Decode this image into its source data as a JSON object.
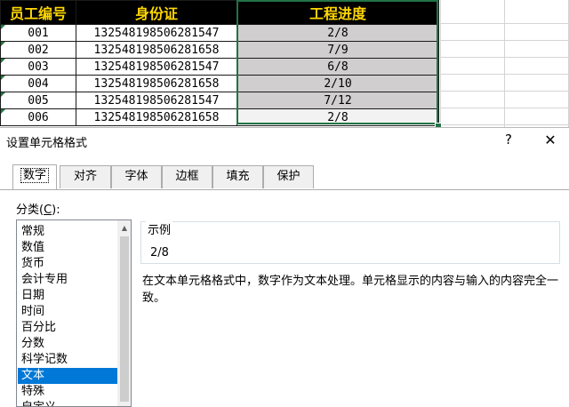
{
  "sheet": {
    "headers": [
      "员工编号",
      "身份证",
      "工程进度"
    ],
    "rows": [
      [
        "001",
        "13254819850628154​7",
        "2/8"
      ],
      [
        "002",
        "132548198506281658",
        "7/9"
      ],
      [
        "003",
        "132548198506281547",
        "6/8"
      ],
      [
        "004",
        "132548198506281658",
        "2/10"
      ],
      [
        "005",
        "132548198506281547",
        "7/12"
      ],
      [
        "006",
        "132548198506281658",
        "2/8"
      ]
    ],
    "header_bg": "#000000",
    "header_text_color": "#ffd700",
    "progress_fill": "#d0cece",
    "selection_color": "#217346"
  },
  "dialog": {
    "title": "设置单元格格式",
    "help_glyph": "?",
    "close_glyph": "✕",
    "tabs": [
      "数字",
      "对齐",
      "字体",
      "边框",
      "填充",
      "保护"
    ],
    "active_tab": "数字",
    "category_label_prefix": "分类(",
    "category_label_key": "C",
    "category_label_suffix": "):",
    "categories": [
      "常规",
      "数值",
      "货币",
      "会计专用",
      "日期",
      "时间",
      "百分比",
      "分数",
      "科学记数",
      "文本",
      "特殊",
      "自定义"
    ],
    "selected_category": "文本",
    "sample_label": "示例",
    "sample_value": "2/8",
    "description_line1": "在文本单元格格式中，数字作为文本处理。单元格显示的内容与输入的内容完全一",
    "description_line2": "致。",
    "scroll_up_glyph": "▲",
    "selection_color": "#0078d7"
  }
}
